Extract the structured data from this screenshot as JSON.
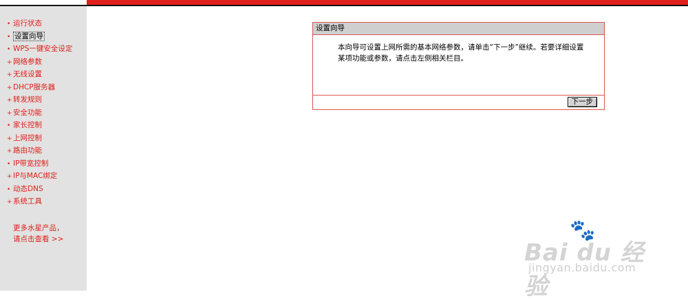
{
  "sidebar": {
    "items": [
      {
        "label": "运行状态",
        "active": false
      },
      {
        "label": "设置向导",
        "active": true
      },
      {
        "label": "WPS一键安全设定",
        "active": false
      },
      {
        "label": "网络参数",
        "active": false
      },
      {
        "label": "无线设置",
        "active": false
      },
      {
        "label": "DHCP服务器",
        "active": false
      },
      {
        "label": "转发规则",
        "active": false
      },
      {
        "label": "安全功能",
        "active": false
      },
      {
        "label": "家长控制",
        "active": false
      },
      {
        "label": "上网控制",
        "active": false
      },
      {
        "label": "路由功能",
        "active": false
      },
      {
        "label": "IP带宽控制",
        "active": false
      },
      {
        "label": "IP与MAC绑定",
        "active": false
      },
      {
        "label": "动态DNS",
        "active": false
      },
      {
        "label": "系统工具",
        "active": false
      }
    ],
    "bullet_active": "•",
    "bullet_default": "+",
    "more_line1": "更多水星产品，",
    "more_line2": "请点击查看 >>"
  },
  "wizard": {
    "title": "设置向导",
    "description": "本向导可设置上网所需的基本网络参数，请单击“下一步”继续。若要详细设置某项功能或参数，请点击左侧相关栏目。",
    "next_label": "下一步"
  },
  "watermark": {
    "brand": "Bai du 经验",
    "site": "jingyan.baidu.com"
  },
  "colors": {
    "accent_red": "#e0201b",
    "sidebar_bg": "#e2e2e2",
    "panel_header_bg": "#cfcfcf",
    "panel_border": "#d9534f"
  }
}
